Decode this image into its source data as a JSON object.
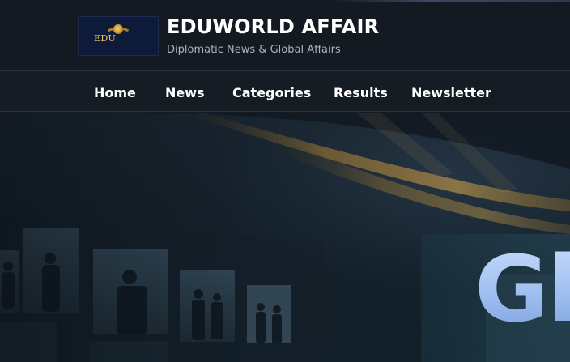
{
  "header": {
    "logo": {
      "text": "EDU"
    },
    "title": "EDUWORLD AFFAIR",
    "tagline": "Diplomatic News & Global Affairs"
  },
  "nav": {
    "items": [
      {
        "label": "Home"
      },
      {
        "label": "News"
      },
      {
        "label": "Categories"
      },
      {
        "label": "Results"
      },
      {
        "label": "Newsletter"
      }
    ]
  },
  "hero": {
    "heading_visible": "Gl"
  },
  "colors": {
    "background": "#141a22",
    "nav_text": "#ffffff",
    "tagline": "#aab3bf",
    "hero_heading": "#a9c8f2",
    "logo_gold": "#e9c266",
    "logo_navy": "#0d1a3a"
  }
}
